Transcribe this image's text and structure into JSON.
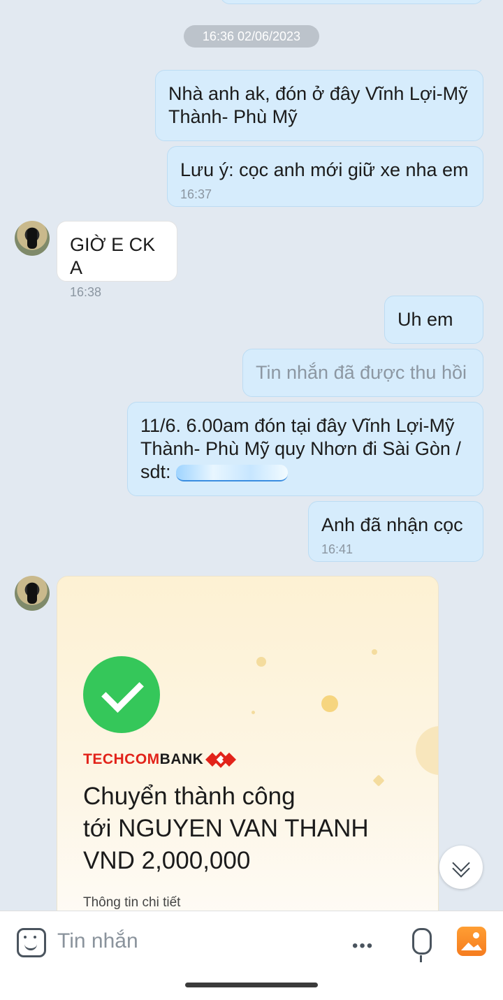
{
  "chat": {
    "date_separator": "16:36 02/06/2023",
    "messages": [
      {
        "text": "Nhà anh ak, đón ở đây Vĩnh Lợi-Mỹ Thành- Phù Mỹ"
      },
      {
        "text": "Lưu ý: cọc anh mới giữ xe nha em",
        "time": "16:37"
      },
      {
        "text": "GIỜ E CK A",
        "time": "16:38"
      },
      {
        "text": "Uh em"
      },
      {
        "text": "Tin nhắn đã được thu hồi"
      },
      {
        "text": "11/6. 6.00am đón tại đây Vĩnh Lợi-Mỹ Thành- Phù Mỹ quy Nhơn đi Sài Gòn / sdt:"
      },
      {
        "text": "Anh đã nhận cọc",
        "time": "16:41"
      }
    ],
    "transfer": {
      "brand_prefix": "TECHCOM",
      "brand_suffix": "BANK",
      "line1": "Chuyển thành công",
      "line2": "tới NGUYEN VAN THANH",
      "amount": "VND 2,000,000",
      "detail": "Thông tin chi tiết"
    }
  },
  "input": {
    "placeholder": "Tin nhắn",
    "more_icon": "•••"
  },
  "colors": {
    "outgoing_bubble": "#d6ecfc",
    "incoming_bubble": "#ffffff",
    "background": "#e2e9f1",
    "success_green": "#35c75a",
    "techcom_red": "#e2231a"
  }
}
